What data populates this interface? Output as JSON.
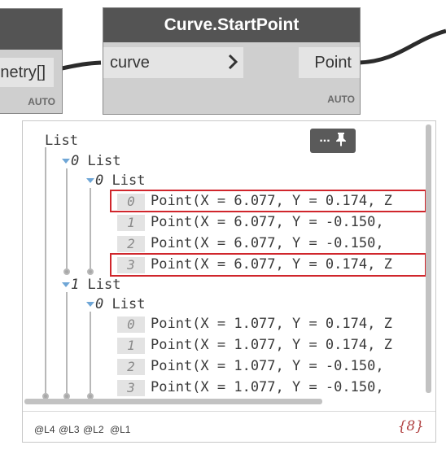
{
  "left_node": {
    "output_port_label": "netry[]",
    "lacing": "AUTO"
  },
  "main_node": {
    "title": "Curve.StartPoint",
    "input_port_label": "curve",
    "output_port_label": "Point",
    "lacing": "AUTO"
  },
  "preview": {
    "root_label": "List",
    "pin_button_label": "...",
    "groups": [
      {
        "index_label": "0",
        "label": "List",
        "sublist": {
          "index_label": "0",
          "label": "List",
          "items": [
            {
              "index": "0",
              "text": "Point(X = 6.077, Y = 0.174, Z",
              "highlighted": true
            },
            {
              "index": "1",
              "text": "Point(X = 6.077, Y = -0.150,",
              "highlighted": false
            },
            {
              "index": "2",
              "text": "Point(X = 6.077, Y = -0.150,",
              "highlighted": false
            },
            {
              "index": "3",
              "text": "Point(X = 6.077, Y = 0.174, Z",
              "highlighted": true
            }
          ]
        }
      },
      {
        "index_label": "1",
        "label": "List",
        "sublist": {
          "index_label": "0",
          "label": "List",
          "items": [
            {
              "index": "0",
              "text": "Point(X = 1.077, Y = 0.174, Z",
              "highlighted": false
            },
            {
              "index": "1",
              "text": "Point(X = 1.077, Y = 0.174, Z",
              "highlighted": false
            },
            {
              "index": "2",
              "text": "Point(X = 1.077, Y = -0.150,",
              "highlighted": false
            },
            {
              "index": "3",
              "text": "Point(X = 1.077, Y = -0.150,",
              "highlighted": false
            }
          ]
        }
      }
    ],
    "levels": [
      "@L4",
      "@L3",
      "@L2",
      "@L1"
    ],
    "count": "{8}"
  },
  "colors": {
    "node_header": "#545454",
    "highlight_border": "#d0262c",
    "count_color": "#b04040"
  }
}
